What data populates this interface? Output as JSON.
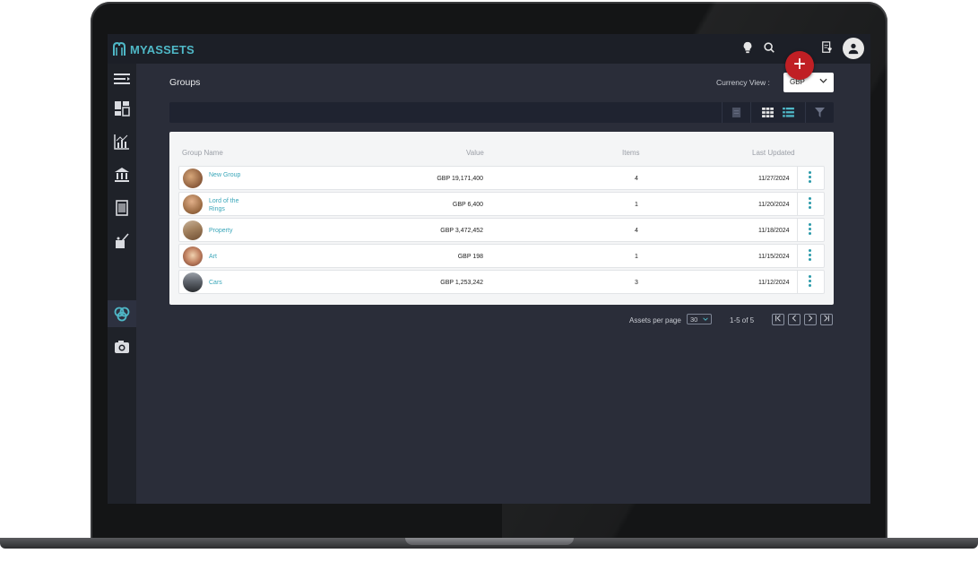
{
  "app": {
    "logo_text": "MYASSETS",
    "brand_color": "#4fb8c7",
    "accent_red": "#c01f24"
  },
  "topbar": {
    "icons": [
      "lightbulb-icon",
      "search-icon",
      "document-heart-icon",
      "user-icon"
    ],
    "add_button_label": "+"
  },
  "sidebar": {
    "items": [
      {
        "name": "menu-collapse-icon"
      },
      {
        "name": "dashboard-icon"
      },
      {
        "name": "analytics-icon"
      },
      {
        "name": "institution-icon"
      },
      {
        "name": "document-icon"
      },
      {
        "name": "assets-icon"
      },
      {
        "name": "groups-icon",
        "active": true
      },
      {
        "name": "camera-icon"
      }
    ]
  },
  "page": {
    "title": "Groups",
    "currency_label": "Currency View :",
    "currency_value": "GBP"
  },
  "table": {
    "headers": {
      "name": "Group Name",
      "value": "Value",
      "items": "Items",
      "updated": "Last Updated"
    },
    "rows": [
      {
        "name": "New Group",
        "value": "GBP 19,171,400",
        "items": "4",
        "updated": "11/27/2024"
      },
      {
        "name": "Lord of the Rings",
        "value": "GBP 6,400",
        "items": "1",
        "updated": "11/20/2024"
      },
      {
        "name": "Property",
        "value": "GBP 3,472,452",
        "items": "4",
        "updated": "11/18/2024"
      },
      {
        "name": "Art",
        "value": "GBP 198",
        "items": "1",
        "updated": "11/15/2024"
      },
      {
        "name": "Cars",
        "value": "GBP 1,253,242",
        "items": "3",
        "updated": "11/12/2024"
      }
    ]
  },
  "pagination": {
    "per_page_label": "Assets per page",
    "per_page_value": "30",
    "range": "1-5 of 5"
  }
}
